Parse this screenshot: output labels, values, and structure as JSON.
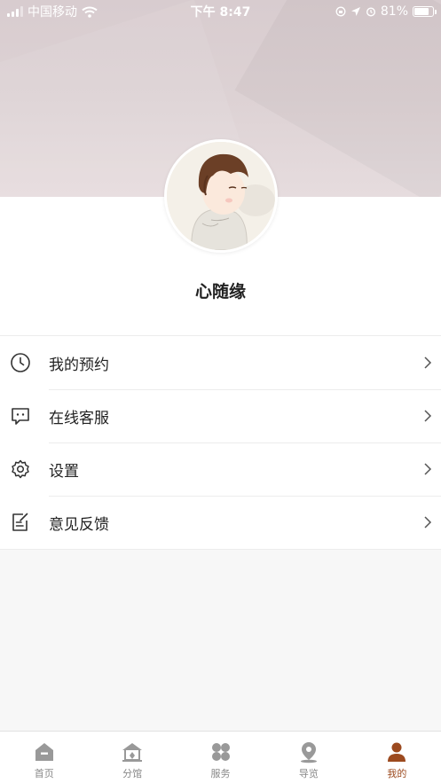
{
  "status_bar": {
    "carrier": "中国移动",
    "time": "下午 8:47",
    "battery": "81%",
    "battery_level": 0.81
  },
  "profile": {
    "username": "心随缘"
  },
  "menu": {
    "items": [
      {
        "label": "我的预约",
        "icon": "clock-icon"
      },
      {
        "label": "在线客服",
        "icon": "chat-icon"
      },
      {
        "label": "设置",
        "icon": "gear-icon"
      },
      {
        "label": "意见反馈",
        "icon": "feedback-icon"
      }
    ]
  },
  "tabbar": {
    "active_color": "#9c4a1f",
    "inactive_color": "#888888",
    "tabs": [
      {
        "label": "首页",
        "icon": "home-icon",
        "active": false
      },
      {
        "label": "分馆",
        "icon": "building-icon",
        "active": false
      },
      {
        "label": "服务",
        "icon": "grid-icon",
        "active": false
      },
      {
        "label": "导览",
        "icon": "location-icon",
        "active": false
      },
      {
        "label": "我的",
        "icon": "person-icon",
        "active": true
      }
    ]
  }
}
